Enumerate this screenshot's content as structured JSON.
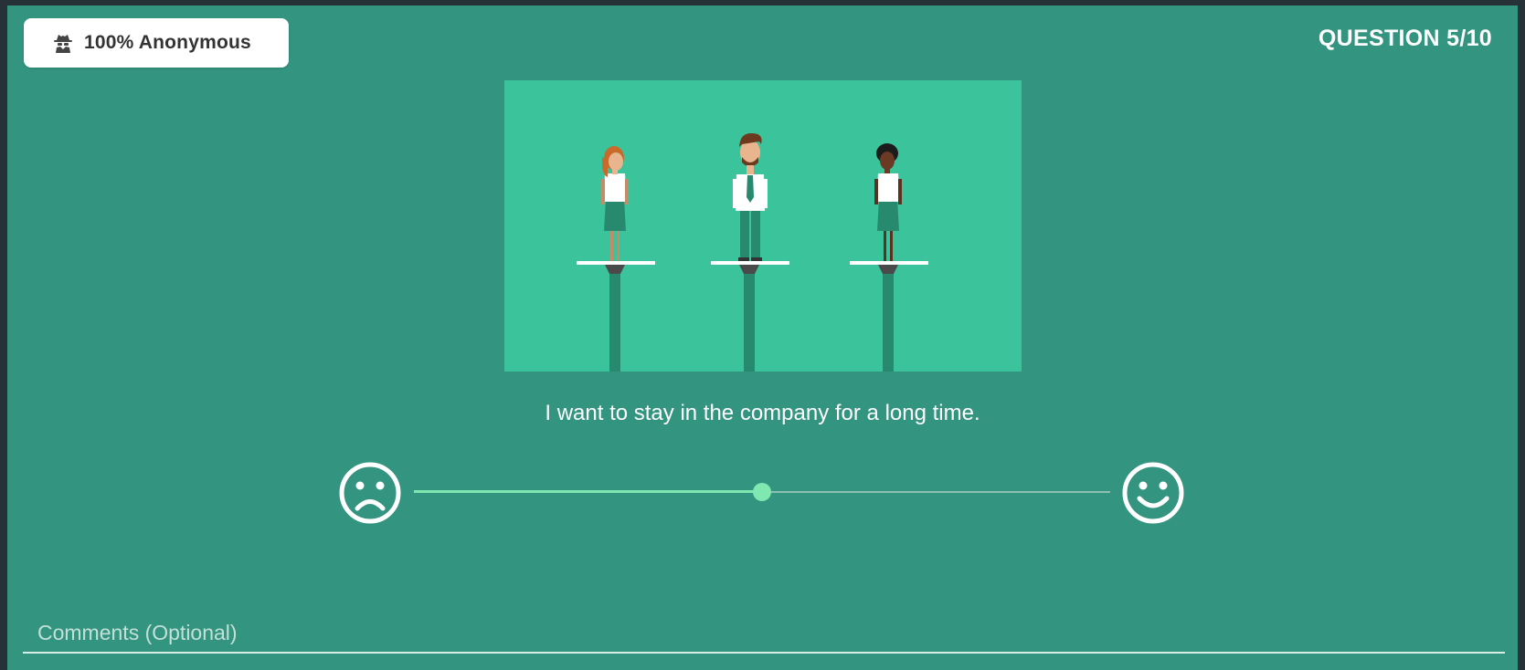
{
  "badge": {
    "icon": "spy-icon",
    "label": "100% Anonymous"
  },
  "question": {
    "counter": "QUESTION 5/10",
    "text": "I want to stay in the company for a long time."
  },
  "rating": {
    "min_icon": "sad-face-icon",
    "max_icon": "happy-face-icon",
    "value": 0.5
  },
  "comments": {
    "placeholder": "Comments (Optional)",
    "value": ""
  },
  "colors": {
    "background": "#339480",
    "illustration_bg": "#3bc49c",
    "accent": "#7ee8b0",
    "frame": "#263238"
  }
}
